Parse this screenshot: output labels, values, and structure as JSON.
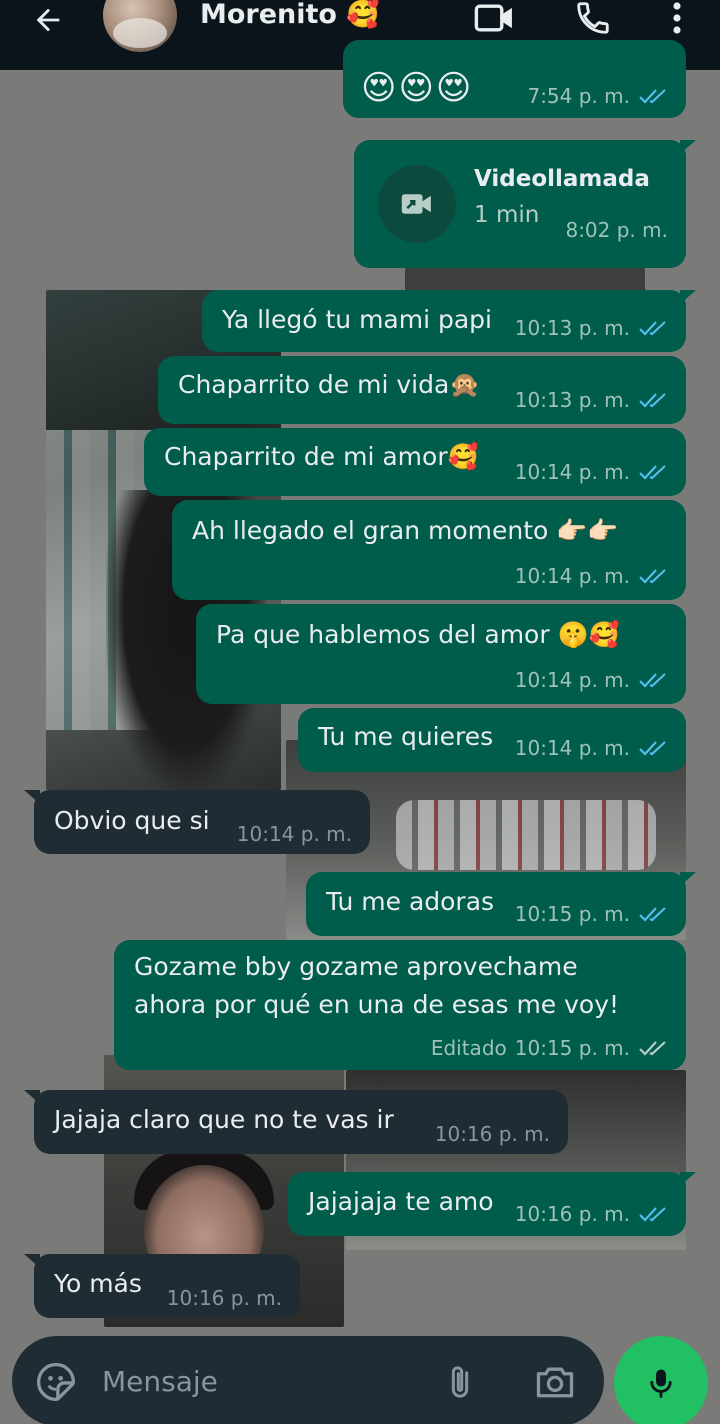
{
  "header": {
    "contact_name": "Morenito 🥰",
    "icons": [
      "back-arrow-icon",
      "video-camera-icon",
      "phone-icon",
      "more-vertical-icon"
    ]
  },
  "messages": [
    {
      "id": "m0",
      "dir": "out",
      "text": "😍😍😍",
      "time": "7:54 p. m.",
      "status": "read"
    },
    {
      "id": "m1",
      "dir": "out",
      "type": "call",
      "title": "Videollamada",
      "duration": "1 min",
      "time": "8:02 p. m."
    },
    {
      "id": "m2",
      "dir": "out",
      "text": "Ya llegó tu mami papi",
      "time": "10:13 p. m.",
      "status": "read"
    },
    {
      "id": "m3",
      "dir": "out",
      "text": "Chaparrito de mi vida🙊",
      "time": "10:13 p. m.",
      "status": "read"
    },
    {
      "id": "m4",
      "dir": "out",
      "text": "Chaparrito de mi amor🥰",
      "time": "10:14 p. m.",
      "status": "read"
    },
    {
      "id": "m5",
      "dir": "out",
      "text": "Ah llegado el gran momento 👉🏻👉🏻",
      "time": "10:14 p. m.",
      "status": "read"
    },
    {
      "id": "m6",
      "dir": "out",
      "text": "Pa que hablemos del amor 🤫🥰",
      "time": "10:14 p. m.",
      "status": "read"
    },
    {
      "id": "m7",
      "dir": "out",
      "text": "Tu me quieres",
      "time": "10:14 p. m.",
      "status": "read"
    },
    {
      "id": "m8",
      "dir": "in",
      "text": "Obvio que si",
      "time": "10:14 p. m."
    },
    {
      "id": "m9",
      "dir": "out",
      "text": "Tu me adoras",
      "time": "10:15 p. m.",
      "status": "read"
    },
    {
      "id": "m10",
      "dir": "out",
      "lines": [
        "Gozame bby gozame aprovechame",
        "ahora por qué en una de esas me voy!"
      ],
      "edited": "Editado",
      "time": "10:15 p. m.",
      "status": "delivered"
    },
    {
      "id": "m11",
      "dir": "in",
      "text": "Jajaja claro que no te vas ir",
      "time": "10:16 p. m."
    },
    {
      "id": "m12",
      "dir": "out",
      "text": "Jajajaja te amo",
      "time": "10:16 p. m.",
      "status": "read"
    },
    {
      "id": "m13",
      "dir": "in",
      "text": "Yo más",
      "time": "10:16 p. m."
    }
  ],
  "composer": {
    "placeholder": "Mensaje",
    "icons": [
      "sticker-emoji-icon",
      "paperclip-icon",
      "camera-icon",
      "microphone-icon"
    ]
  },
  "colors": {
    "header_bg": "#0b141a",
    "bubble_out": "#005c4b",
    "bubble_in": "#1f2c34",
    "read_tick": "#53bdeb",
    "mic_button": "#21c063"
  }
}
